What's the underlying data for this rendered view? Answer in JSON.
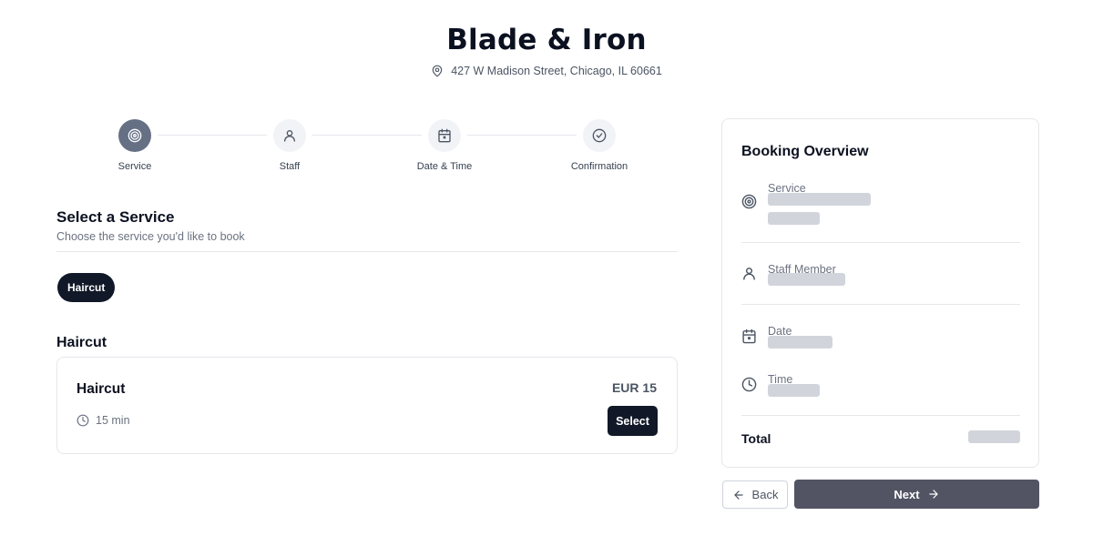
{
  "shop": {
    "name": "Blade & Iron",
    "address": "427 W Madison Street, Chicago, IL 60661",
    "address_icon": "map-pin-icon"
  },
  "stepper": {
    "current_step": 1,
    "steps": [
      {
        "label": "Service",
        "icon": "target-icon",
        "active": true
      },
      {
        "label": "Staff",
        "icon": "user-icon",
        "active": false
      },
      {
        "label": "Date & Time",
        "icon": "calendar-icon",
        "active": false
      },
      {
        "label": "Confirmation",
        "icon": "check-circle-icon",
        "active": false
      }
    ]
  },
  "service_section": {
    "title": "Select a Service",
    "subtitle": "Choose the service you'd like to book",
    "categories": [
      {
        "label": "Haircut",
        "selected": true
      }
    ],
    "groups": [
      {
        "title": "Haircut",
        "services": [
          {
            "name": "Haircut",
            "price": "EUR 15",
            "duration": "15 min",
            "select_label": "Select"
          }
        ]
      }
    ]
  },
  "overview": {
    "title": "Booking Overview",
    "service_label": "Service",
    "staff_label": "Staff Member",
    "date_label": "Date",
    "time_label": "Time",
    "total_label": "Total",
    "values_loaded": false
  },
  "actions": {
    "back_label": "Back",
    "next_label": "Next"
  },
  "colors": {
    "primary": "#111827",
    "active_step": "#667085",
    "next_button": "#525463",
    "skeleton": "#d1d5db",
    "border": "#e5e7eb"
  }
}
